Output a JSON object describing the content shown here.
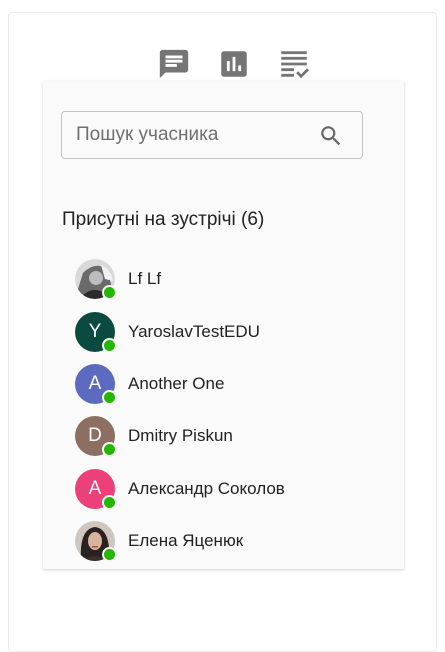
{
  "tabs": [
    {
      "icon": "chat-icon"
    },
    {
      "icon": "poll-chart-icon"
    },
    {
      "icon": "checklist-icon"
    }
  ],
  "search": {
    "placeholder": "Пошук учасника",
    "icon": "search-icon"
  },
  "participants": {
    "title": "Присутні на зустрічі (6)",
    "items": [
      {
        "name": "Lf Lf",
        "avatar_type": "photo",
        "initial": "",
        "color": "#9e9e9e"
      },
      {
        "name": "YaroslavTestEDU",
        "avatar_type": "initial",
        "initial": "Y",
        "color": "#0b4a3f"
      },
      {
        "name": "Another One",
        "avatar_type": "initial",
        "initial": "A",
        "color": "#5c6bc0"
      },
      {
        "name": "Dmitry Piskun",
        "avatar_type": "initial",
        "initial": "D",
        "color": "#8d6e63"
      },
      {
        "name": "Александр Соколов",
        "avatar_type": "initial",
        "initial": "A",
        "color": "#ec407a"
      },
      {
        "name": "Елена Яценюк",
        "avatar_type": "photo",
        "initial": "",
        "color": "#3a3030"
      }
    ],
    "online_color": "#25b700"
  }
}
